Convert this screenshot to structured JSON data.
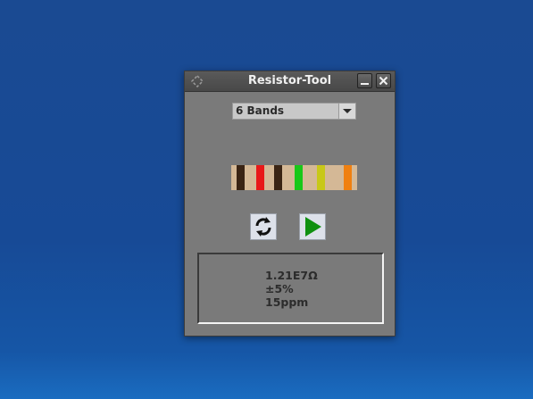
{
  "window": {
    "title": "Resistor-Tool"
  },
  "band_select": {
    "value": "6 Bands"
  },
  "resistor": {
    "bands": [
      {
        "color": "#3a2414"
      },
      {
        "color": "#e81818"
      },
      {
        "color": "#3a2414"
      },
      {
        "color": "#18c818"
      },
      {
        "color": "#c8c818"
      },
      {
        "color": "#f08010"
      }
    ],
    "body_color": "#d4b896"
  },
  "buttons": {
    "refresh_icon": "refresh-icon",
    "play_icon": "play-icon"
  },
  "result": {
    "resistance": "1.21E7Ω",
    "tolerance": "±5%",
    "temp_coefficient": "15ppm"
  }
}
